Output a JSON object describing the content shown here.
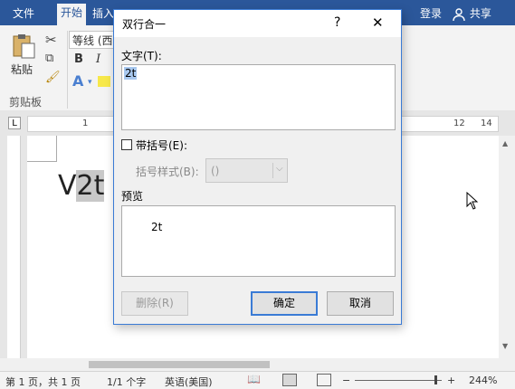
{
  "ribbon": {
    "tabs": [
      "文件",
      "开始",
      "插入"
    ],
    "login": "登录",
    "share": "共享",
    "paste_label": "粘贴",
    "clipboard_group": "剪贴板",
    "font_name": "等线 (西",
    "bold": "B",
    "italic": "I"
  },
  "ruler": {
    "ticks": [
      "L",
      "1",
      "12",
      "14"
    ]
  },
  "document": {
    "visible_text": "V2t"
  },
  "dialog": {
    "title": "双行合一",
    "help": "?",
    "close": "✕",
    "text_label": "文字(T):",
    "text_value": "2t",
    "bracket_checkbox_label": "带括号(E):",
    "bracket_checked": false,
    "bracket_style_label": "括号样式(B):",
    "bracket_style_value": "()",
    "preview_label": "预览",
    "preview_text": "2t",
    "delete_button": "删除(R)",
    "ok_button": "确定",
    "cancel_button": "取消"
  },
  "status": {
    "page": "第 1 页，共 1 页",
    "words": "1/1 个字",
    "language": "英语(美国)",
    "zoom_minus": "−",
    "zoom_plus": "+",
    "zoom": "244%"
  }
}
